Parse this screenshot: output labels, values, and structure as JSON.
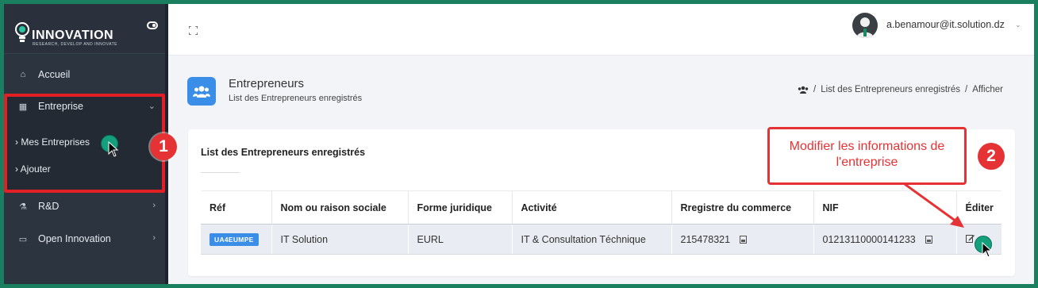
{
  "sidebar": {
    "brand": {
      "name": "INNOVATION",
      "tagline": "RESEARCH, DEVELOP AND INNOVATE"
    },
    "items": [
      {
        "label": "Accueil",
        "icon": "home-icon"
      },
      {
        "label": "Entreprise",
        "icon": "building-icon"
      },
      {
        "label": "Mes Entreprises"
      },
      {
        "label": "Ajouter"
      },
      {
        "label": "R&D",
        "icon": "flask-icon"
      },
      {
        "label": "Open Innovation",
        "icon": "card-icon"
      }
    ]
  },
  "topbar": {
    "user_email": "a.benamour@it.solution.dz"
  },
  "page": {
    "title": "Entrepreneurs",
    "subtitle": "List des Entrepreneurs enregistrés",
    "breadcrumb": [
      "List des Entrepreneurs enregistrés",
      "Afficher"
    ]
  },
  "card": {
    "title": "List des Entrepreneurs enregistrés",
    "columns": [
      "Réf",
      "Nom ou raison sociale",
      "Forme juridique",
      "Activité",
      "Rregistre du commerce",
      "NIF",
      "Éditer"
    ],
    "rows": [
      {
        "ref": "UA4EUMPE",
        "name": "IT Solution",
        "forme": "EURL",
        "activite": "IT & Consultation Téchnique",
        "registre": "215478321",
        "nif": "01213110000141233"
      }
    ]
  },
  "annotations": {
    "step1": "1",
    "step2": "2",
    "callout": "Modifier les informations de l'entreprise"
  },
  "colors": {
    "accent": "#3a8ee8",
    "sidebar": "#2c3440",
    "highlight": "#e53335",
    "cursor": "#14a07d"
  }
}
